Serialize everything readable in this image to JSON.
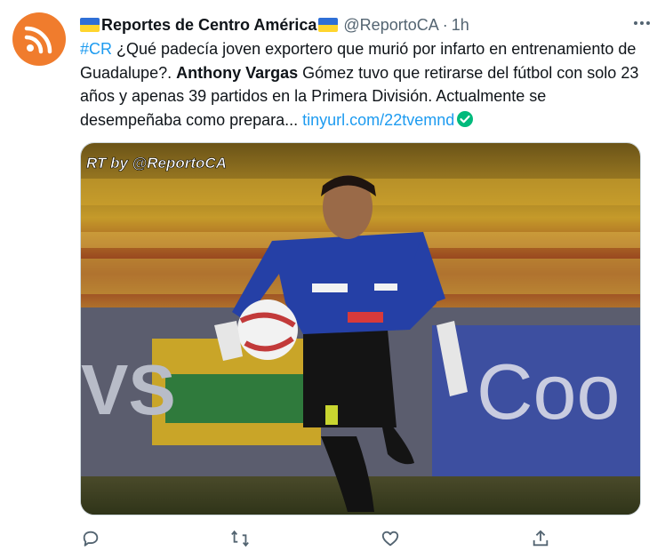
{
  "account": {
    "name": "Reportes de Centro América",
    "handle": "@ReportoCA",
    "separator": "·",
    "time": "1h",
    "avatar_icon": "rss-icon"
  },
  "tweet": {
    "hashtag": "#CR",
    "text_part1": " ¿Qué padecía joven exportero que murió por infarto en entrenamiento de Guadalupe?. ",
    "bold_name": "Anthony Vargas",
    "text_part2": " Gómez tuvo que retirarse del fútbol con solo 23 años y apenas 39 partidos en la Primera División. Actualmente se desempeñaba como prepara... ",
    "link": "tinyurl.com/22tvemnd"
  },
  "media": {
    "watermark": "RT by @ReportoCA",
    "description_icon": "goalkeeper-photo"
  },
  "actions": {
    "reply_icon": "reply-icon",
    "retweet_icon": "retweet-icon",
    "like_icon": "like-icon",
    "share_icon": "share-icon"
  },
  "colors": {
    "link": "#1d9bf0",
    "secondary_text": "#536471",
    "avatar": "#f07c2d",
    "verified": "#00ba7c"
  }
}
